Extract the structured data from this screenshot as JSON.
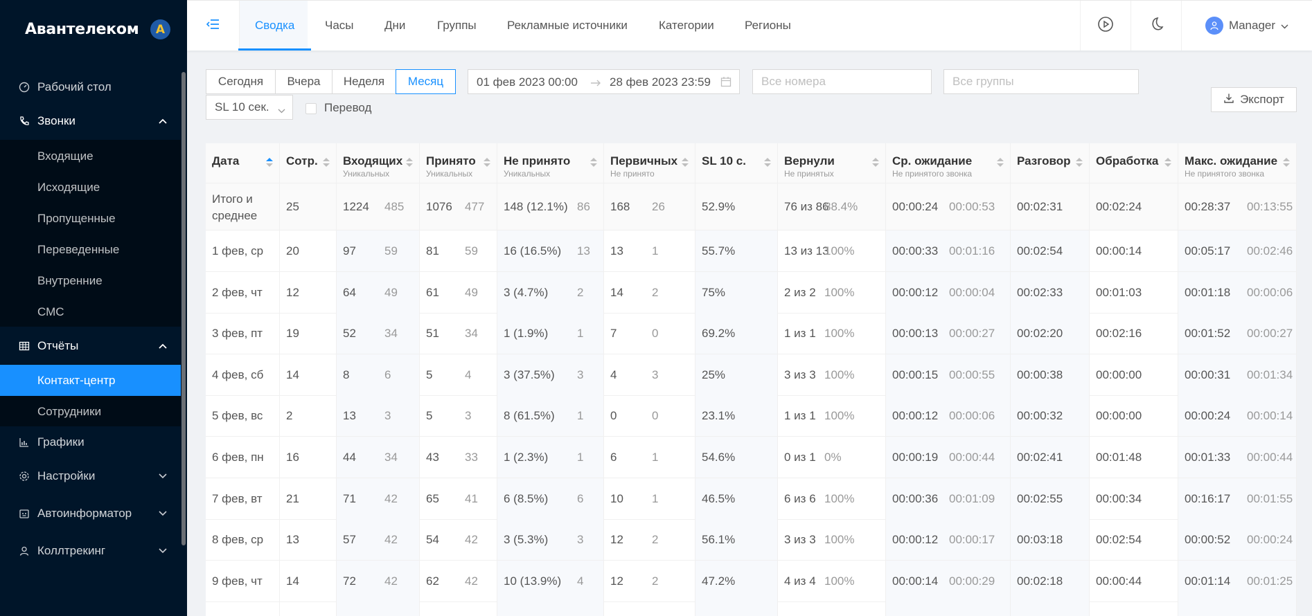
{
  "app": {
    "brand": "Авантелеком",
    "logo_letter": "A"
  },
  "sidebar": {
    "items": [
      {
        "label": "Рабочий стол",
        "icon": "dashboard-icon"
      },
      {
        "label": "Звонки",
        "icon": "phone-icon",
        "expanded": true
      },
      {
        "label": "Отчёты",
        "icon": "table-icon",
        "expanded": true
      },
      {
        "label": "Графики",
        "icon": "bar-chart-icon"
      },
      {
        "label": "Настройки",
        "icon": "gear-icon",
        "expanded": false
      },
      {
        "label": "Автоинформатор",
        "icon": "robot-icon",
        "expanded": false
      },
      {
        "label": "Коллтрекинг",
        "icon": "user-icon",
        "expanded": false
      }
    ],
    "calls_sub": [
      "Входящие",
      "Исходящие",
      "Пропущенные",
      "Переведенные",
      "Внутренние",
      "СМС"
    ],
    "reports_sub": [
      "Контакт-центр",
      "Сотрудники"
    ],
    "active_sub": "Контакт-центр"
  },
  "header": {
    "tabs": [
      "Сводка",
      "Часы",
      "Дни",
      "Группы",
      "Рекламные источники",
      "Категории",
      "Регионы"
    ],
    "active_tab": "Сводка",
    "user": "Manager"
  },
  "filters": {
    "periods": [
      "Сегодня",
      "Вчера",
      "Неделя",
      "Месяц"
    ],
    "active_period": "Месяц",
    "date_from": "01 фев 2023 00:00",
    "date_to": "28 фев 2023 23:59",
    "numbers_placeholder": "Все номера",
    "groups_placeholder": "Все группы",
    "sl_select": "SL 10 сек.",
    "transfer_label": "Перевод",
    "transfer_checked": false,
    "export_label": "Экспорт"
  },
  "table": {
    "columns": [
      {
        "title": "Дата",
        "sub": "",
        "sort_active": true
      },
      {
        "title": "Сотр.",
        "sub": ""
      },
      {
        "title": "Входящих",
        "sub": "Уникальных"
      },
      {
        "title": "Принято",
        "sub": "Уникальных"
      },
      {
        "title": "Не принято",
        "sub": "Уникальных"
      },
      {
        "title": "Первичных",
        "sub": "Не принято"
      },
      {
        "title": "SL 10 с.",
        "sub": ""
      },
      {
        "title": "Вернули",
        "sub": "Не принятых"
      },
      {
        "title": "Ср. ожидание",
        "sub": "Не принятого звонка"
      },
      {
        "title": "Разговор",
        "sub": ""
      },
      {
        "title": "Обработка",
        "sub": ""
      },
      {
        "title": "Макс. ожидание",
        "sub": "Не принятого звонка"
      }
    ],
    "total": {
      "date": "Итого и среднее",
      "emp": "25",
      "in": "1224",
      "in_u": "485",
      "acc": "1076",
      "acc_u": "477",
      "miss": "148 (12.1%)",
      "miss_u": "86",
      "prim": "168",
      "prim_u": "26",
      "sl": "52.9%",
      "ret": "76 из 86",
      "ret_p": "88.4%",
      "avg": "00:00:24",
      "avg_u": "00:00:53",
      "talk": "00:02:31",
      "proc": "00:02:24",
      "max": "00:28:37",
      "max_u": "00:13:55"
    },
    "rows": [
      {
        "date": "1 фев, ср",
        "emp": "20",
        "in": "97",
        "in_u": "59",
        "acc": "81",
        "acc_u": "59",
        "miss": "16 (16.5%)",
        "miss_u": "13",
        "prim": "13",
        "prim_u": "1",
        "sl": "55.7%",
        "ret": "13 из 13",
        "ret_p": "100%",
        "avg": "00:00:33",
        "avg_u": "00:01:16",
        "talk": "00:02:54",
        "proc": "00:00:14",
        "max": "00:05:17",
        "max_u": "00:02:46"
      },
      {
        "date": "2 фев, чт",
        "emp": "12",
        "in": "64",
        "in_u": "49",
        "acc": "61",
        "acc_u": "49",
        "miss": "3 (4.7%)",
        "miss_u": "2",
        "prim": "14",
        "prim_u": "2",
        "sl": "75%",
        "ret": "2 из 2",
        "ret_p": "100%",
        "avg": "00:00:12",
        "avg_u": "00:00:04",
        "talk": "00:02:33",
        "proc": "00:01:03",
        "max": "00:01:18",
        "max_u": "00:00:06"
      },
      {
        "date": "3 фев, пт",
        "emp": "19",
        "in": "52",
        "in_u": "34",
        "acc": "51",
        "acc_u": "34",
        "miss": "1 (1.9%)",
        "miss_u": "1",
        "prim": "7",
        "prim_u": "0",
        "sl": "69.2%",
        "ret": "1 из 1",
        "ret_p": "100%",
        "avg": "00:00:13",
        "avg_u": "00:00:27",
        "talk": "00:02:20",
        "proc": "00:02:16",
        "max": "00:01:52",
        "max_u": "00:00:27"
      },
      {
        "date": "4 фев, сб",
        "emp": "14",
        "in": "8",
        "in_u": "6",
        "acc": "5",
        "acc_u": "4",
        "miss": "3 (37.5%)",
        "miss_u": "3",
        "prim": "4",
        "prim_u": "3",
        "sl": "25%",
        "ret": "3 из 3",
        "ret_p": "100%",
        "avg": "00:00:15",
        "avg_u": "00:00:55",
        "talk": "00:00:38",
        "proc": "00:00:00",
        "max": "00:00:31",
        "max_u": "00:01:34"
      },
      {
        "date": "5 фев, вс",
        "emp": "2",
        "in": "13",
        "in_u": "3",
        "acc": "5",
        "acc_u": "3",
        "miss": "8 (61.5%)",
        "miss_u": "1",
        "prim": "0",
        "prim_u": "0",
        "sl": "23.1%",
        "ret": "1 из 1",
        "ret_p": "100%",
        "avg": "00:00:12",
        "avg_u": "00:00:06",
        "talk": "00:00:32",
        "proc": "00:00:00",
        "max": "00:00:24",
        "max_u": "00:00:14"
      },
      {
        "date": "6 фев, пн",
        "emp": "16",
        "in": "44",
        "in_u": "34",
        "acc": "43",
        "acc_u": "33",
        "miss": "1 (2.3%)",
        "miss_u": "1",
        "prim": "6",
        "prim_u": "1",
        "sl": "54.6%",
        "ret": "0 из 1",
        "ret_p": "0%",
        "avg": "00:00:19",
        "avg_u": "00:00:44",
        "talk": "00:02:41",
        "proc": "00:01:48",
        "max": "00:01:33",
        "max_u": "00:00:44"
      },
      {
        "date": "7 фев, вт",
        "emp": "21",
        "in": "71",
        "in_u": "42",
        "acc": "65",
        "acc_u": "41",
        "miss": "6 (8.5%)",
        "miss_u": "6",
        "prim": "10",
        "prim_u": "1",
        "sl": "46.5%",
        "ret": "6 из 6",
        "ret_p": "100%",
        "avg": "00:00:36",
        "avg_u": "00:01:09",
        "talk": "00:02:55",
        "proc": "00:00:34",
        "max": "00:16:17",
        "max_u": "00:01:55"
      },
      {
        "date": "8 фев, ср",
        "emp": "13",
        "in": "57",
        "in_u": "42",
        "acc": "54",
        "acc_u": "42",
        "miss": "3 (5.3%)",
        "miss_u": "3",
        "prim": "12",
        "prim_u": "2",
        "sl": "56.1%",
        "ret": "3 из 3",
        "ret_p": "100%",
        "avg": "00:00:12",
        "avg_u": "00:00:17",
        "talk": "00:03:18",
        "proc": "00:02:54",
        "max": "00:00:52",
        "max_u": "00:00:24"
      },
      {
        "date": "9 фев, чт",
        "emp": "14",
        "in": "72",
        "in_u": "42",
        "acc": "62",
        "acc_u": "42",
        "miss": "10 (13.9%)",
        "miss_u": "4",
        "prim": "12",
        "prim_u": "2",
        "sl": "47.2%",
        "ret": "4 из 4",
        "ret_p": "100%",
        "avg": "00:00:14",
        "avg_u": "00:00:29",
        "talk": "00:02:18",
        "proc": "00:00:44",
        "max": "00:01:14",
        "max_u": "00:01:25"
      }
    ]
  }
}
